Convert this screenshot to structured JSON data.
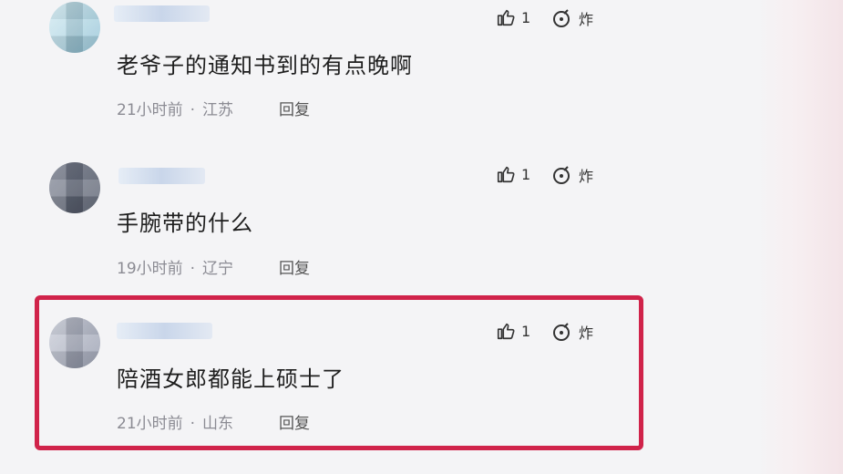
{
  "comments": [
    {
      "text": "老爷子的通知书到的有点晚啊",
      "time": "21小时前",
      "location": "江苏",
      "reply_label": "回复",
      "like_count": "1",
      "blast_label": "炸"
    },
    {
      "text": "手腕带的什么",
      "time": "19小时前",
      "location": "辽宁",
      "reply_label": "回复",
      "like_count": "1",
      "blast_label": "炸"
    },
    {
      "text": "陪酒女郎都能上硕士了",
      "time": "21小时前",
      "location": "山东",
      "reply_label": "回复",
      "like_count": "1",
      "blast_label": "炸"
    }
  ],
  "highlight_color": "#d0234a"
}
